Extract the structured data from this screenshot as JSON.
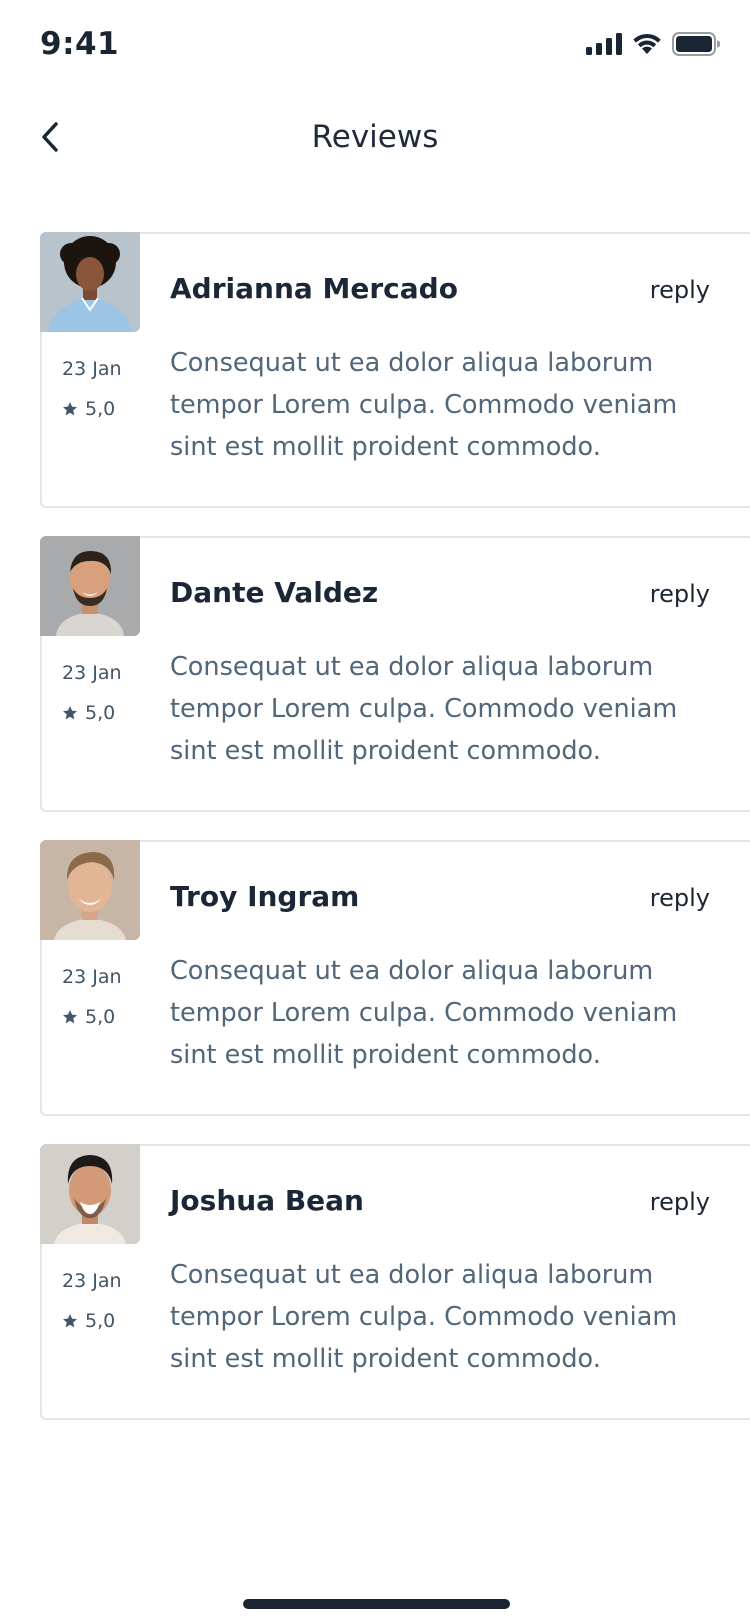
{
  "status_bar": {
    "time": "9:41",
    "signal_icon": "cellular-signal-icon",
    "wifi_icon": "wifi-icon",
    "battery_icon": "battery-icon"
  },
  "nav": {
    "title": "Reviews",
    "back_icon": "chevron-left-icon"
  },
  "colors": {
    "text_dark": "#1b2636",
    "text_muted": "#52667a",
    "card_border": "#dde8f1",
    "accent": "#1a2433"
  },
  "reviews": [
    {
      "name": "Adrianna Mercado",
      "reply_label": "reply",
      "date": "23 Jan",
      "rating": "5,0",
      "text": "Consequat ut ea dolor aliqua laborum tempor Lorem culpa. Commodo veniam sint est mollit proident commodo."
    },
    {
      "name": "Dante Valdez",
      "reply_label": "reply",
      "date": "23 Jan",
      "rating": "5,0",
      "text": "Consequat ut ea dolor aliqua laborum tempor Lorem culpa. Commodo veniam sint est mollit proident commodo."
    },
    {
      "name": "Troy Ingram",
      "reply_label": "reply",
      "date": "23 Jan",
      "rating": "5,0",
      "text": "Consequat ut ea dolor aliqua laborum tempor Lorem culpa. Commodo veniam sint est mollit proident commodo."
    },
    {
      "name": "Joshua Bean",
      "reply_label": "reply",
      "date": "23 Jan",
      "rating": "5,0",
      "text": "Consequat ut ea dolor aliqua laborum tempor Lorem culpa. Commodo veniam sint est mollit proident commodo."
    }
  ]
}
